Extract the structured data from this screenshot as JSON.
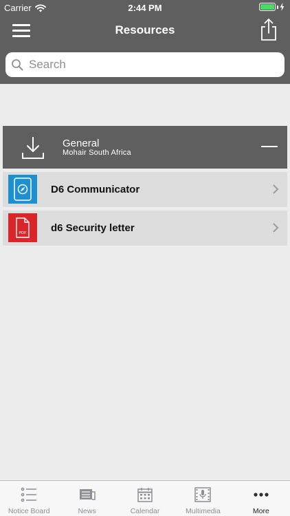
{
  "status_bar": {
    "carrier": "Carrier",
    "time": "2:44 PM"
  },
  "nav": {
    "title": "Resources"
  },
  "search": {
    "placeholder": "Search",
    "value": ""
  },
  "section": {
    "title": "General",
    "subtitle": "Mohair South Africa"
  },
  "items": [
    {
      "label": "D6 Communicator",
      "icon": "compass-app-icon",
      "color": "#1e8fcf"
    },
    {
      "label": "d6 Security letter",
      "icon": "pdf-document-icon",
      "color": "#d9262b",
      "badge": "PDF"
    }
  ],
  "tabs": [
    {
      "label": "Notice Board",
      "icon": "list-icon",
      "active": false
    },
    {
      "label": "News",
      "icon": "news-icon",
      "active": false
    },
    {
      "label": "Calendar",
      "icon": "calendar-icon",
      "active": false
    },
    {
      "label": "Multimedia",
      "icon": "multimedia-icon",
      "active": false
    },
    {
      "label": "More",
      "icon": "more-icon",
      "active": true
    }
  ],
  "colors": {
    "header_bg": "#5f5f5f",
    "page_bg": "#ececec",
    "row_bg": "#dcdcdc",
    "battery": "#4cd964"
  }
}
